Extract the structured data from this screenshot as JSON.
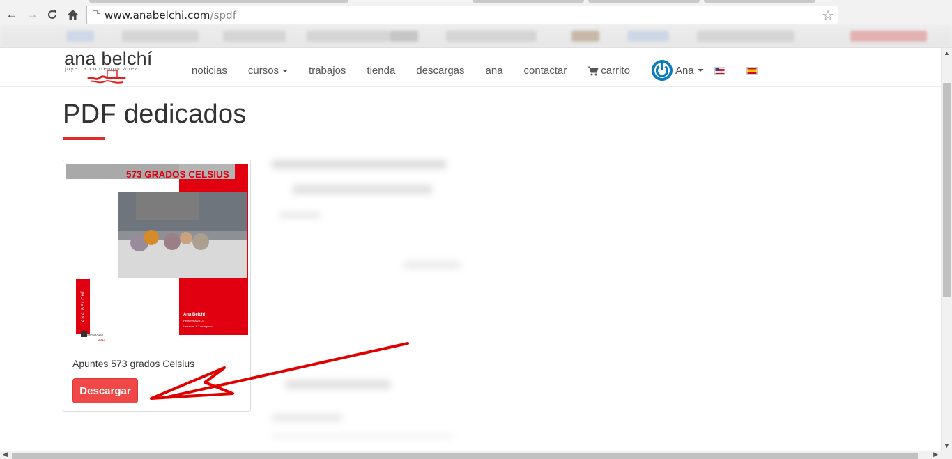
{
  "browser": {
    "url_host": "www.anabelchi.com",
    "url_path": "/spdf"
  },
  "site": {
    "logo_name": "ana belchí",
    "logo_tagline": "joyería contemporánea",
    "nav": [
      {
        "label": "noticias"
      },
      {
        "label": "cursos"
      },
      {
        "label": "trabajos"
      },
      {
        "label": "tienda"
      },
      {
        "label": "descargas"
      },
      {
        "label": "ana"
      },
      {
        "label": "contactar"
      },
      {
        "label": "carrito"
      }
    ],
    "user_label": "Ana",
    "brand_color": "#e02b2b",
    "power_icon_color": "#0a7bbf"
  },
  "main": {
    "title": "PDF dedicados",
    "items": [
      {
        "cover_title": "573 GRADOS CELSIUS",
        "cover_author": "Ana Belchí",
        "cover_meta1": "Febrerería 2013",
        "cover_meta2": "Valencia, 1-3 de agosto",
        "cover_spine": "ANA BELCHÍ",
        "cover_logo": "SUPERALIA",
        "cover_year": "2013",
        "caption": "Apuntes 573 grados Celsius",
        "button_label": "Descargar"
      }
    ]
  }
}
